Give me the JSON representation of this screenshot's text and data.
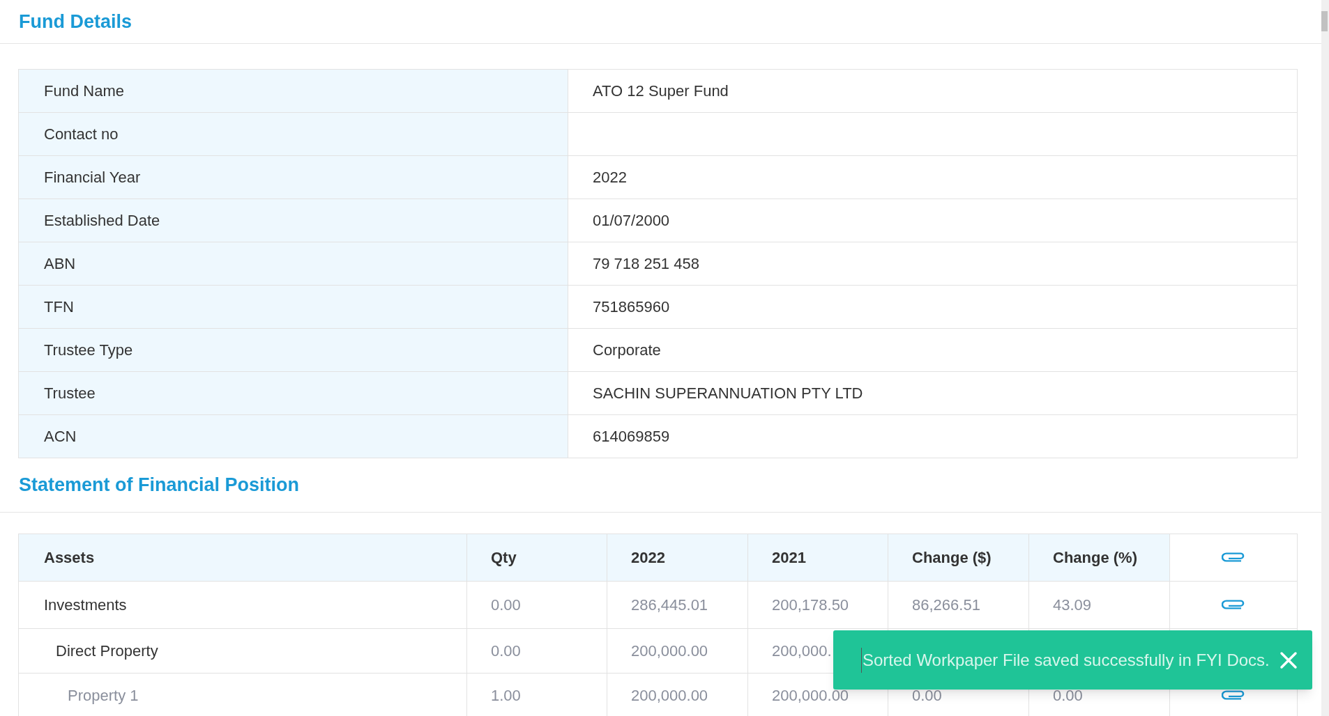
{
  "fund_details": {
    "title": "Fund Details",
    "rows": [
      {
        "label": "Fund Name",
        "value": "ATO 12 Super Fund"
      },
      {
        "label": "Contact no"
      },
      {
        "label": "Financial Year",
        "value": "2022"
      },
      {
        "label": "Established Date",
        "value": "01/07/2000"
      },
      {
        "label": "ABN",
        "value": "79 718 251 458"
      },
      {
        "label": "TFN",
        "value": "751865960"
      },
      {
        "label": "Trustee Type",
        "value": "Corporate"
      },
      {
        "label": "Trustee",
        "value": "SACHIN SUPERANNUATION PTY LTD"
      },
      {
        "label": "ACN",
        "value": "614069859"
      }
    ]
  },
  "statement": {
    "title": "Statement of Financial Position",
    "columns": [
      "Assets",
      "Qty",
      "2022",
      "2021",
      "Change ($)",
      "Change (%)"
    ],
    "rows": [
      {
        "name": "Investments",
        "qty": "0.00",
        "y2022": "286,445.01",
        "y2021": "200,178.50",
        "change": "86,266.51",
        "change_pct": "43.09",
        "attachment": true,
        "children": [
          {
            "name": "Direct Property",
            "qty": "0.00",
            "y2022": "200,000.00",
            "y2021": "200,000.",
            "children": [
              {
                "name": "Property 1",
                "qty": "1.00",
                "y2022": "200,000.00",
                "y2021": "200,000.00",
                "change": "0.00",
                "change_pct": "0.00",
                "attachment": true
              }
            ]
          }
        ]
      }
    ]
  },
  "toast": {
    "message": "Sorted Workpaper File saved successfully in FYI Docs."
  }
}
